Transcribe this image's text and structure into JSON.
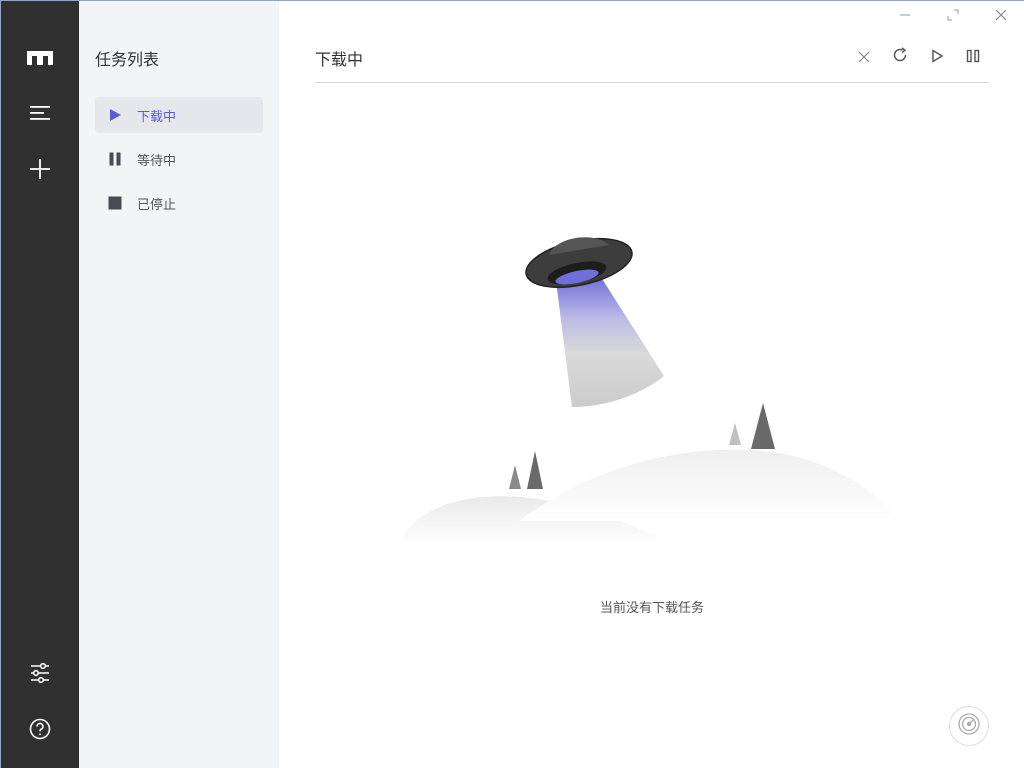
{
  "rail": {
    "items": [
      {
        "name": "logo-icon"
      },
      {
        "name": "menu-icon"
      },
      {
        "name": "add-icon"
      },
      {
        "name": "settings-sliders-icon"
      },
      {
        "name": "help-icon"
      }
    ]
  },
  "sidebar": {
    "title": "任务列表",
    "items": [
      {
        "label": "下载中",
        "icon": "play-icon",
        "active": true
      },
      {
        "label": "等待中",
        "icon": "pause-icon",
        "active": false
      },
      {
        "label": "已停止",
        "icon": "stop-icon",
        "active": false
      }
    ]
  },
  "main": {
    "title": "下载中",
    "toolbar": [
      "close-icon",
      "refresh-icon",
      "play-outline-icon",
      "pause-outline-icon"
    ],
    "empty_text": "当前没有下载任务"
  },
  "colors": {
    "rail_bg": "#303030",
    "sidebar_bg": "#f3f4f6",
    "accent": "#5b5bd6"
  }
}
